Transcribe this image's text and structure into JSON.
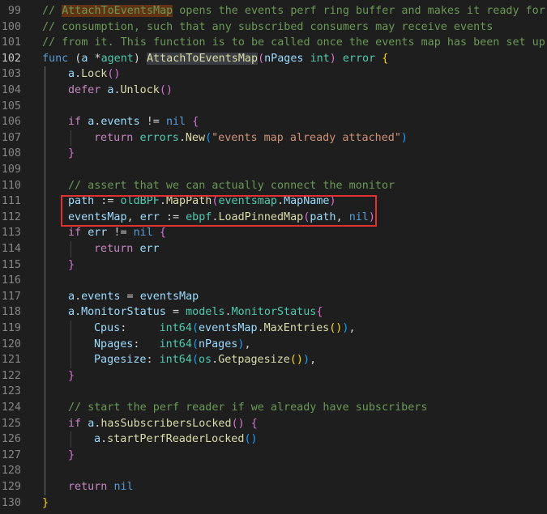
{
  "editor": {
    "lines": [
      {
        "number": "99",
        "indent": 0,
        "tokens": [
          {
            "t": "// ",
            "c": "tok-comment"
          },
          {
            "t": "AttachToEventsMap",
            "c": "tok-comment tok-highlight"
          },
          {
            "t": " opens the events perf ring buffer and makes it ready for",
            "c": "tok-comment"
          }
        ]
      },
      {
        "number": "100",
        "indent": 0,
        "tokens": [
          {
            "t": "// consumption, such that any subscribed consumers may receive events",
            "c": "tok-comment"
          }
        ]
      },
      {
        "number": "101",
        "indent": 0,
        "tokens": [
          {
            "t": "// from it. This function is to be called once the events map has been set up.",
            "c": "tok-comment"
          }
        ]
      },
      {
        "number": "102",
        "indent": 0,
        "active": true,
        "tokens": [
          {
            "t": "func",
            "c": "tok-keyword"
          },
          {
            "t": " (",
            "c": "tok-plain"
          },
          {
            "t": "a",
            "c": "tok-var"
          },
          {
            "t": " *",
            "c": "tok-plain"
          },
          {
            "t": "agent",
            "c": "tok-type"
          },
          {
            "t": ") ",
            "c": "tok-plain"
          },
          {
            "t": "AttachToEventsMap",
            "c": "tok-func tok-highlight-plain"
          },
          {
            "t": "(",
            "c": "tok-paren"
          },
          {
            "t": "nPages",
            "c": "tok-var"
          },
          {
            "t": " ",
            "c": "tok-plain"
          },
          {
            "t": "int",
            "c": "tok-type"
          },
          {
            "t": ") ",
            "c": "tok-paren"
          },
          {
            "t": "error",
            "c": "tok-type"
          },
          {
            "t": " ",
            "c": "tok-plain"
          },
          {
            "t": "{",
            "c": "tok-brace"
          }
        ]
      },
      {
        "number": "103",
        "indent": 1,
        "tokens": [
          {
            "t": "a",
            "c": "tok-var"
          },
          {
            "t": ".",
            "c": "tok-plain"
          },
          {
            "t": "Lock",
            "c": "tok-func"
          },
          {
            "t": "()",
            "c": "tok-paren"
          }
        ]
      },
      {
        "number": "104",
        "indent": 1,
        "tokens": [
          {
            "t": "defer",
            "c": "tok-control"
          },
          {
            "t": " ",
            "c": "tok-plain"
          },
          {
            "t": "a",
            "c": "tok-var"
          },
          {
            "t": ".",
            "c": "tok-plain"
          },
          {
            "t": "Unlock",
            "c": "tok-func"
          },
          {
            "t": "()",
            "c": "tok-paren"
          }
        ]
      },
      {
        "number": "105",
        "indent": 0,
        "tokens": []
      },
      {
        "number": "106",
        "indent": 1,
        "tokens": [
          {
            "t": "if",
            "c": "tok-control"
          },
          {
            "t": " ",
            "c": "tok-plain"
          },
          {
            "t": "a",
            "c": "tok-var"
          },
          {
            "t": ".",
            "c": "tok-plain"
          },
          {
            "t": "events",
            "c": "tok-var"
          },
          {
            "t": " != ",
            "c": "tok-plain"
          },
          {
            "t": "nil",
            "c": "tok-keyword"
          },
          {
            "t": " ",
            "c": "tok-plain"
          },
          {
            "t": "{",
            "c": "tok-paren"
          }
        ]
      },
      {
        "number": "107",
        "indent": 2,
        "tokens": [
          {
            "t": "return",
            "c": "tok-control"
          },
          {
            "t": " ",
            "c": "tok-plain"
          },
          {
            "t": "errors",
            "c": "tok-type"
          },
          {
            "t": ".",
            "c": "tok-plain"
          },
          {
            "t": "New",
            "c": "tok-func"
          },
          {
            "t": "(",
            "c": "tok-paren-blue"
          },
          {
            "t": "\"events map already attached\"",
            "c": "tok-string"
          },
          {
            "t": ")",
            "c": "tok-paren-blue"
          }
        ]
      },
      {
        "number": "108",
        "indent": 1,
        "tokens": [
          {
            "t": "}",
            "c": "tok-paren"
          }
        ]
      },
      {
        "number": "109",
        "indent": 0,
        "tokens": []
      },
      {
        "number": "110",
        "indent": 1,
        "tokens": [
          {
            "t": "// assert that we can actually connect the monitor",
            "c": "tok-comment"
          }
        ]
      },
      {
        "number": "111",
        "indent": 1,
        "tokens": [
          {
            "t": "path",
            "c": "tok-var"
          },
          {
            "t": " := ",
            "c": "tok-plain"
          },
          {
            "t": "oldBPF",
            "c": "tok-type"
          },
          {
            "t": ".",
            "c": "tok-plain"
          },
          {
            "t": "MapPath",
            "c": "tok-func"
          },
          {
            "t": "(",
            "c": "tok-paren"
          },
          {
            "t": "eventsmap",
            "c": "tok-type"
          },
          {
            "t": ".",
            "c": "tok-plain"
          },
          {
            "t": "MapName",
            "c": "tok-var"
          },
          {
            "t": ")",
            "c": "tok-paren"
          }
        ]
      },
      {
        "number": "112",
        "indent": 1,
        "tokens": [
          {
            "t": "eventsMap",
            "c": "tok-var"
          },
          {
            "t": ", ",
            "c": "tok-plain"
          },
          {
            "t": "err",
            "c": "tok-var"
          },
          {
            "t": " := ",
            "c": "tok-plain"
          },
          {
            "t": "ebpf",
            "c": "tok-type"
          },
          {
            "t": ".",
            "c": "tok-plain"
          },
          {
            "t": "LoadPinnedMap",
            "c": "tok-func"
          },
          {
            "t": "(",
            "c": "tok-paren"
          },
          {
            "t": "path",
            "c": "tok-var"
          },
          {
            "t": ", ",
            "c": "tok-plain"
          },
          {
            "t": "nil",
            "c": "tok-keyword"
          },
          {
            "t": ")",
            "c": "tok-paren"
          }
        ]
      },
      {
        "number": "113",
        "indent": 1,
        "tokens": [
          {
            "t": "if",
            "c": "tok-control"
          },
          {
            "t": " ",
            "c": "tok-plain"
          },
          {
            "t": "err",
            "c": "tok-var"
          },
          {
            "t": " != ",
            "c": "tok-plain"
          },
          {
            "t": "nil",
            "c": "tok-keyword"
          },
          {
            "t": " ",
            "c": "tok-plain"
          },
          {
            "t": "{",
            "c": "tok-paren"
          }
        ]
      },
      {
        "number": "114",
        "indent": 2,
        "tokens": [
          {
            "t": "return",
            "c": "tok-control"
          },
          {
            "t": " ",
            "c": "tok-plain"
          },
          {
            "t": "err",
            "c": "tok-var"
          }
        ]
      },
      {
        "number": "115",
        "indent": 1,
        "tokens": [
          {
            "t": "}",
            "c": "tok-paren"
          }
        ]
      },
      {
        "number": "116",
        "indent": 0,
        "tokens": []
      },
      {
        "number": "117",
        "indent": 1,
        "tokens": [
          {
            "t": "a",
            "c": "tok-var"
          },
          {
            "t": ".",
            "c": "tok-plain"
          },
          {
            "t": "events",
            "c": "tok-var"
          },
          {
            "t": " = ",
            "c": "tok-plain"
          },
          {
            "t": "eventsMap",
            "c": "tok-var"
          }
        ]
      },
      {
        "number": "118",
        "indent": 1,
        "tokens": [
          {
            "t": "a",
            "c": "tok-var"
          },
          {
            "t": ".",
            "c": "tok-plain"
          },
          {
            "t": "MonitorStatus",
            "c": "tok-var"
          },
          {
            "t": " = ",
            "c": "tok-plain"
          },
          {
            "t": "models",
            "c": "tok-type"
          },
          {
            "t": ".",
            "c": "tok-plain"
          },
          {
            "t": "MonitorStatus",
            "c": "tok-type"
          },
          {
            "t": "{",
            "c": "tok-paren"
          }
        ]
      },
      {
        "number": "119",
        "indent": 2,
        "tokens": [
          {
            "t": "Cpus",
            "c": "tok-var"
          },
          {
            "t": ":     ",
            "c": "tok-plain"
          },
          {
            "t": "int64",
            "c": "tok-type"
          },
          {
            "t": "(",
            "c": "tok-paren-blue"
          },
          {
            "t": "eventsMap",
            "c": "tok-var"
          },
          {
            "t": ".",
            "c": "tok-plain"
          },
          {
            "t": "MaxEntries",
            "c": "tok-func"
          },
          {
            "t": "()",
            "c": "tok-brace"
          },
          {
            "t": ")",
            "c": "tok-paren-blue"
          },
          {
            "t": ",",
            "c": "tok-plain"
          }
        ]
      },
      {
        "number": "120",
        "indent": 2,
        "tokens": [
          {
            "t": "Npages",
            "c": "tok-var"
          },
          {
            "t": ":   ",
            "c": "tok-plain"
          },
          {
            "t": "int64",
            "c": "tok-type"
          },
          {
            "t": "(",
            "c": "tok-paren-blue"
          },
          {
            "t": "nPages",
            "c": "tok-var"
          },
          {
            "t": ")",
            "c": "tok-paren-blue"
          },
          {
            "t": ",",
            "c": "tok-plain"
          }
        ]
      },
      {
        "number": "121",
        "indent": 2,
        "tokens": [
          {
            "t": "Pagesize",
            "c": "tok-var"
          },
          {
            "t": ": ",
            "c": "tok-plain"
          },
          {
            "t": "int64",
            "c": "tok-type"
          },
          {
            "t": "(",
            "c": "tok-paren-blue"
          },
          {
            "t": "os",
            "c": "tok-type"
          },
          {
            "t": ".",
            "c": "tok-plain"
          },
          {
            "t": "Getpagesize",
            "c": "tok-func"
          },
          {
            "t": "()",
            "c": "tok-brace"
          },
          {
            "t": ")",
            "c": "tok-paren-blue"
          },
          {
            "t": ",",
            "c": "tok-plain"
          }
        ]
      },
      {
        "number": "122",
        "indent": 1,
        "tokens": [
          {
            "t": "}",
            "c": "tok-paren"
          }
        ]
      },
      {
        "number": "123",
        "indent": 0,
        "tokens": []
      },
      {
        "number": "124",
        "indent": 1,
        "tokens": [
          {
            "t": "// start the perf reader if we already have subscribers",
            "c": "tok-comment"
          }
        ]
      },
      {
        "number": "125",
        "indent": 1,
        "tokens": [
          {
            "t": "if",
            "c": "tok-control"
          },
          {
            "t": " ",
            "c": "tok-plain"
          },
          {
            "t": "a",
            "c": "tok-var"
          },
          {
            "t": ".",
            "c": "tok-plain"
          },
          {
            "t": "hasSubscribersLocked",
            "c": "tok-func"
          },
          {
            "t": "()",
            "c": "tok-paren"
          },
          {
            "t": " ",
            "c": "tok-plain"
          },
          {
            "t": "{",
            "c": "tok-paren"
          }
        ]
      },
      {
        "number": "126",
        "indent": 2,
        "tokens": [
          {
            "t": "a",
            "c": "tok-var"
          },
          {
            "t": ".",
            "c": "tok-plain"
          },
          {
            "t": "startPerfReaderLocked",
            "c": "tok-func"
          },
          {
            "t": "()",
            "c": "tok-paren-blue"
          }
        ]
      },
      {
        "number": "127",
        "indent": 1,
        "tokens": [
          {
            "t": "}",
            "c": "tok-paren"
          }
        ]
      },
      {
        "number": "128",
        "indent": 0,
        "tokens": []
      },
      {
        "number": "129",
        "indent": 1,
        "tokens": [
          {
            "t": "return",
            "c": "tok-control"
          },
          {
            "t": " ",
            "c": "tok-plain"
          },
          {
            "t": "nil",
            "c": "tok-keyword"
          }
        ]
      },
      {
        "number": "130",
        "indent": 0,
        "tokens": [
          {
            "t": "}",
            "c": "tok-brace"
          }
        ]
      }
    ]
  },
  "colors": {
    "background": "#1e1e1e",
    "selection_box": "#e03030",
    "line_number": "#858585",
    "active_line_number": "#c6c6c6"
  }
}
